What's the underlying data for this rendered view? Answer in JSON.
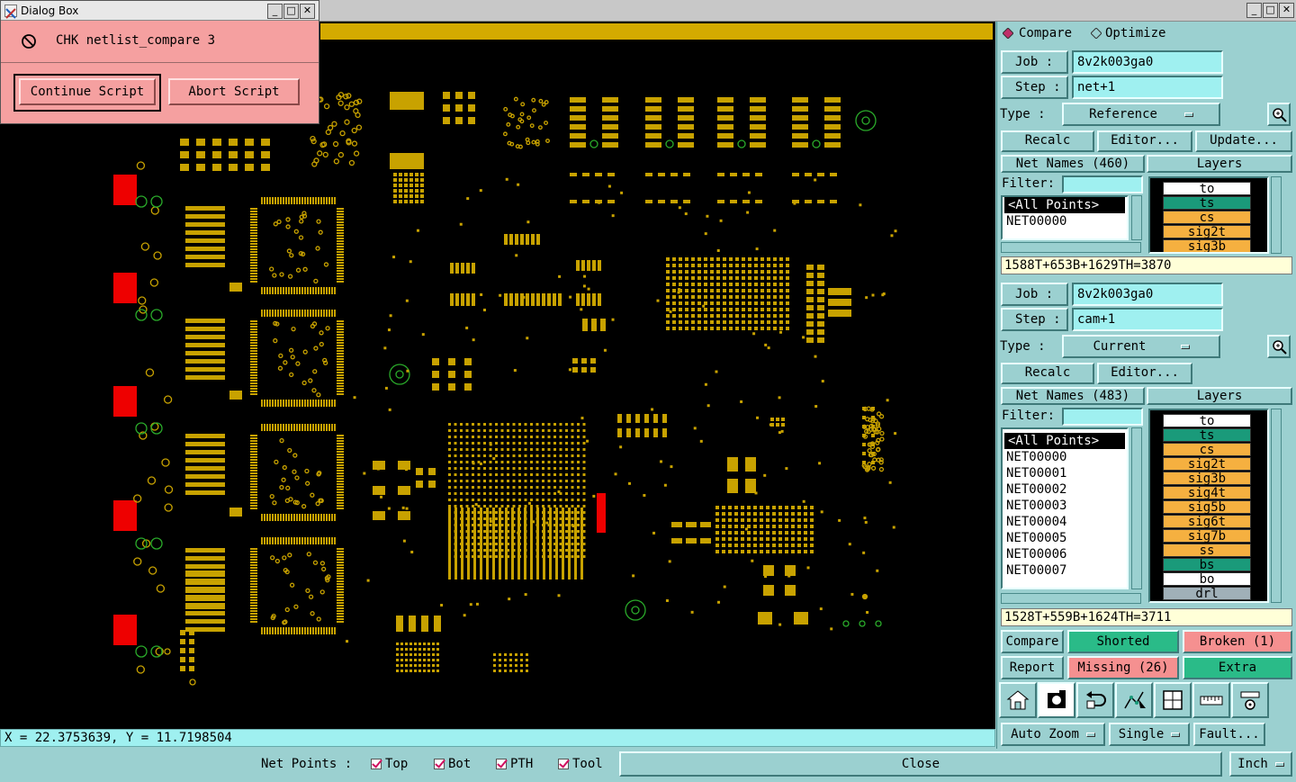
{
  "window": {
    "min": "_",
    "max": "□",
    "close": "✕"
  },
  "dialog": {
    "title": "Dialog Box",
    "message": "CHK netlist_compare 3",
    "continue_label": "Continue Script",
    "abort_label": "Abort Script"
  },
  "coord_readout": "X = 22.3753639, Y = 11.7198504",
  "bottom": {
    "net_points_label": "Net Points :",
    "checks": [
      "Top",
      "Bot",
      "PTH",
      "Tool"
    ],
    "close_label": "Close",
    "unit_label": "Inch"
  },
  "panel": {
    "mode_compare": "Compare",
    "mode_optimize": "Optimize",
    "job_label": "Job  :",
    "step_label": "Step :",
    "type_label": "Type :",
    "recalc_label": "Recalc",
    "editor_label": "Editor...",
    "update_label": "Update...",
    "filter_label": "Filter:",
    "layers_label": "Layers",
    "ref": {
      "job": "8v2k003ga0",
      "step": "net+1",
      "type": "Reference",
      "net_names": "Net Names (460)",
      "nets": [
        "<All Points>",
        "NET00000"
      ],
      "summary": "1588T+653B+1629TH=3870"
    },
    "cur": {
      "job": "8v2k003ga0",
      "step": "cam+1",
      "type": "Current",
      "net_names": "Net Names (483)",
      "nets": [
        "<All Points>",
        "NET00000",
        "NET00001",
        "NET00002",
        "NET00003",
        "NET00004",
        "NET00005",
        "NET00006",
        "NET00007"
      ],
      "summary": "1528T+559B+1624TH=3711"
    },
    "ref_layers": [
      {
        "name": "to",
        "color": "#ffffff"
      },
      {
        "name": "ts",
        "color": "#1a9a7a"
      },
      {
        "name": "cs",
        "color": "#f5b040"
      },
      {
        "name": "sig2t",
        "color": "#f5b040"
      },
      {
        "name": "sig3b",
        "color": "#f5b040"
      }
    ],
    "cur_layers": [
      {
        "name": "to",
        "color": "#ffffff"
      },
      {
        "name": "ts",
        "color": "#1a9a7a"
      },
      {
        "name": "cs",
        "color": "#f5b040"
      },
      {
        "name": "sig2t",
        "color": "#f5b040"
      },
      {
        "name": "sig3b",
        "color": "#f5b040"
      },
      {
        "name": "sig4t",
        "color": "#f5b040"
      },
      {
        "name": "sig5b",
        "color": "#f5b040"
      },
      {
        "name": "sig6t",
        "color": "#f5b040"
      },
      {
        "name": "sig7b",
        "color": "#f5b040"
      },
      {
        "name": "ss",
        "color": "#f5b040"
      },
      {
        "name": "bs",
        "color": "#1a9a7a"
      },
      {
        "name": "bo",
        "color": "#ffffff"
      },
      {
        "name": "drl",
        "color": "#a0b0b8"
      }
    ],
    "results": {
      "compare": "Compare",
      "shorted": "Shorted",
      "broken": "Broken (1)",
      "report": "Report",
      "missing": "Missing (26)",
      "extra": "Extra"
    },
    "tools": [
      "home-icon",
      "snapshot-icon",
      "undo-icon",
      "route-icon",
      "window-icon",
      "ruler-icon",
      "settings-icon"
    ],
    "auto_zoom_label": "Auto Zoom",
    "single_label": "Single",
    "fault_label": "Fault...",
    "colors": {
      "green": "#2abb88",
      "red": "#f59090",
      "panel": "#9bd0d0"
    }
  }
}
